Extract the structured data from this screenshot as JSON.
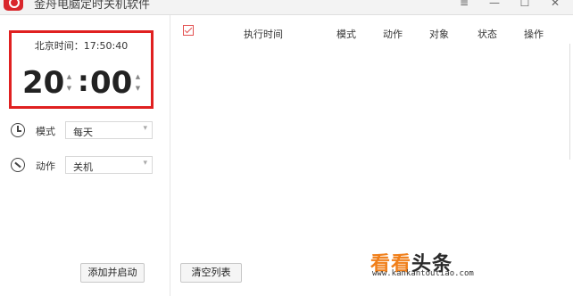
{
  "window": {
    "title": "金舟电脑定时关机软件",
    "minimize_glyph": "—",
    "maximize_glyph": "☐",
    "close_glyph": "✕",
    "menu_glyph": "≡"
  },
  "clock": {
    "current_time_text": "北京时间：17:50:40",
    "hour": "20",
    "minute": "00",
    "colon": ":",
    "spin_up": "▲",
    "spin_down": "▼"
  },
  "options": {
    "mode_label": "模式",
    "mode_value": "每天",
    "action_label": "动作",
    "action_value": "关机",
    "dropdown_glyph": "▾"
  },
  "buttons": {
    "add_and_start": "添加并启动",
    "clear_list": "清空列表"
  },
  "table": {
    "columns": [
      "执行时间",
      "模式",
      "动作",
      "对象",
      "状态",
      "操作"
    ]
  },
  "watermark": {
    "main_a": "看看",
    "main_b": "头条",
    "url": "www.kankantoutiao.com"
  },
  "colors": {
    "highlight_border": "#e02020",
    "app_icon": "#d9262b",
    "watermark_orange": "#f07f1a"
  }
}
